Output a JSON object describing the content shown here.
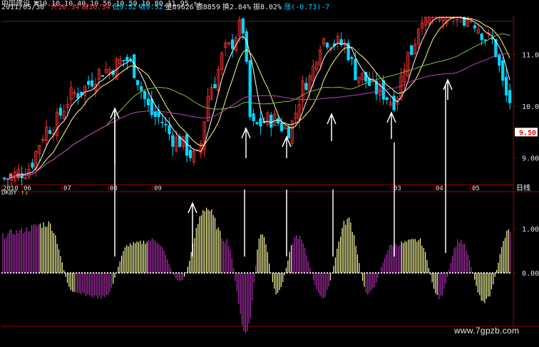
{
  "header": {
    "line1": "中国建设 ₩10.10,10.40,10.56,10.59,10.80,11.95 ↑↓",
    "date": "2011/05/30",
    "items": [
      {
        "label": "开",
        "value": "10.34",
        "color": "#ff4040"
      },
      {
        "label": "高",
        "value": "10.34",
        "color": "#ff4040"
      },
      {
        "label": "低",
        "value": "9.52",
        "color": "#00d0ff"
      },
      {
        "label": "收",
        "value": "9.52",
        "color": "#00d0ff"
      },
      {
        "label": "量",
        "value": "89626",
        "color": "#e8e8e8"
      },
      {
        "label": "额",
        "value": "8859",
        "color": "#e8e8e8"
      },
      {
        "label": "换",
        "value": "2.84%",
        "color": "#e8e8e8"
      },
      {
        "label": "振",
        "value": "8.02%",
        "color": "#e8e8e8"
      },
      {
        "label": "涨",
        "value": "(-0.73)-7",
        "color": "#00d0ff"
      }
    ]
  },
  "indicator": {
    "name": "DKBY",
    "arrows": "↑↓"
  },
  "watermark": "www.7gpzb.com",
  "colors": {
    "up": "#ff3030",
    "down": "#00d8ff",
    "ma_white": "#ffffff",
    "ma_yellow": "#ffff80",
    "ma_green": "#80c040",
    "ma_purple": "#c040c0",
    "osc_yellow": "#ffffa0",
    "osc_purple": "#b030b0",
    "axis": "#a00000",
    "price_tag_bg": "#ffffff",
    "price_tag_text": "#ff0000"
  },
  "chart_data": [
    {
      "type": "candlestick",
      "title": "",
      "ylim": [
        8.5,
        11.75
      ],
      "y_ticks": [
        "11.00",
        "10.00",
        "9.00"
      ],
      "current_price_tag": "9.50",
      "low_label": "8.02",
      "x_tick_labels": [
        "2010",
        "06",
        "07",
        "08",
        "09",
        "03",
        "04",
        "05"
      ],
      "period_label": "日线",
      "marker_arrows": 9
    },
    {
      "type": "bar",
      "title": "DKBY",
      "ylim": [
        -1.2,
        1.2
      ],
      "y_ticks": [
        "1.00",
        "0.00"
      ]
    }
  ]
}
